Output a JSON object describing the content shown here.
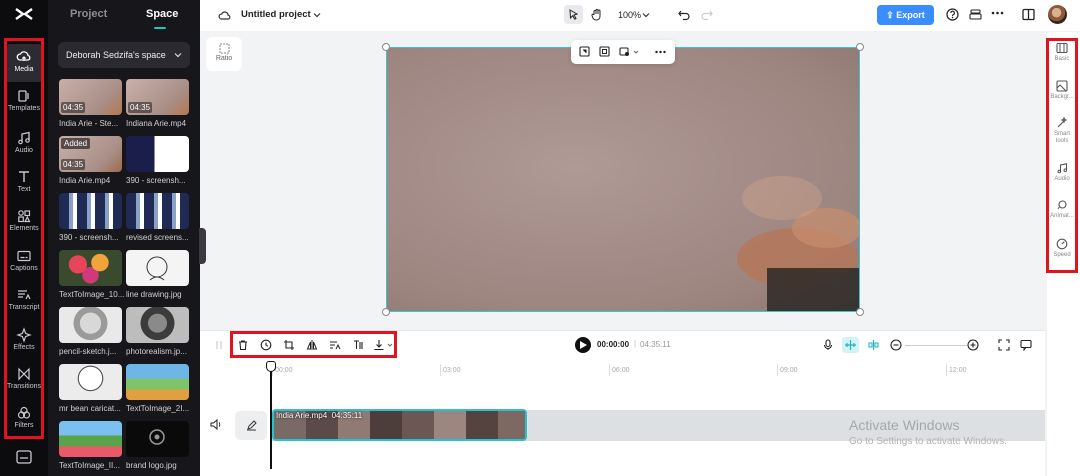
{
  "sidebar": {
    "items": [
      {
        "label": "Media",
        "icon": "cloud-media-icon",
        "active": true
      },
      {
        "label": "Templates",
        "icon": "templates-icon"
      },
      {
        "label": "Audio",
        "icon": "music-note-icon"
      },
      {
        "label": "Text",
        "icon": "text-icon"
      },
      {
        "label": "Elements",
        "icon": "elements-icon"
      },
      {
        "label": "Captions",
        "icon": "captions-icon"
      },
      {
        "label": "Transcript",
        "icon": "transcript-icon"
      },
      {
        "label": "Effects",
        "icon": "effects-icon"
      },
      {
        "label": "Transitions",
        "icon": "transitions-icon"
      },
      {
        "label": "Filters",
        "icon": "filters-icon"
      }
    ]
  },
  "panel": {
    "tabs": [
      {
        "label": "Project"
      },
      {
        "label": "Space",
        "active": true
      }
    ],
    "space_name": "Deborah Sedzifa's space",
    "media": [
      {
        "label": "India Arie - Ste...",
        "duration": "04:35",
        "kind": "video"
      },
      {
        "label": "Indiana Arie.mp4",
        "duration": "04:35",
        "kind": "video"
      },
      {
        "label": "India Arie.mp4",
        "duration": "04:35",
        "badge": "Added",
        "kind": "video"
      },
      {
        "label": "390 - screensh...",
        "kind": "screen"
      },
      {
        "label": "390 - screensh...",
        "kind": "screen-wide"
      },
      {
        "label": "revised screens...",
        "kind": "screen-wide"
      },
      {
        "label": "TextToImage_10...",
        "kind": "flowers"
      },
      {
        "label": "line drawing.jpg",
        "kind": "drawing"
      },
      {
        "label": "pencil-sketch.j...",
        "kind": "sketch"
      },
      {
        "label": "photorealism.jp...",
        "kind": "photo"
      },
      {
        "label": "mr bean caricat...",
        "kind": "caricature"
      },
      {
        "label": "TextToImage_2I...",
        "kind": "landscape"
      },
      {
        "label": "TextToImage_II...",
        "kind": "garden"
      },
      {
        "label": "brand logo.jpg",
        "kind": "logo"
      }
    ]
  },
  "header": {
    "project_title": "Untitled project",
    "zoom": "100%",
    "export_label": "Export"
  },
  "canvas": {
    "ratio_label": "Ratio"
  },
  "right_panel": {
    "items": [
      {
        "label": "Basic",
        "icon": "basic-icon"
      },
      {
        "label": "Backgr...",
        "icon": "background-icon"
      },
      {
        "label": "Smart tools",
        "icon": "smart-tools-icon"
      },
      {
        "label": "Audio",
        "icon": "audio-icon"
      },
      {
        "label": "Animat...",
        "icon": "animation-icon"
      },
      {
        "label": "Speed",
        "icon": "speed-icon"
      }
    ]
  },
  "playback": {
    "current_time": "00:00:00",
    "total_time": "04:35:11"
  },
  "timeline": {
    "ruler": [
      "00:00",
      "03:00",
      "06:00",
      "09:00",
      "12:00"
    ],
    "clip_name": "India Arie.mp4",
    "clip_duration": "04:35:11"
  },
  "watermark": {
    "line1": "Activate Windows",
    "line2": "Go to Settings to activate Windows."
  },
  "colors": {
    "accent": "#17c7c2",
    "export": "#3a8dff",
    "highlight_box": "#e0141e"
  }
}
